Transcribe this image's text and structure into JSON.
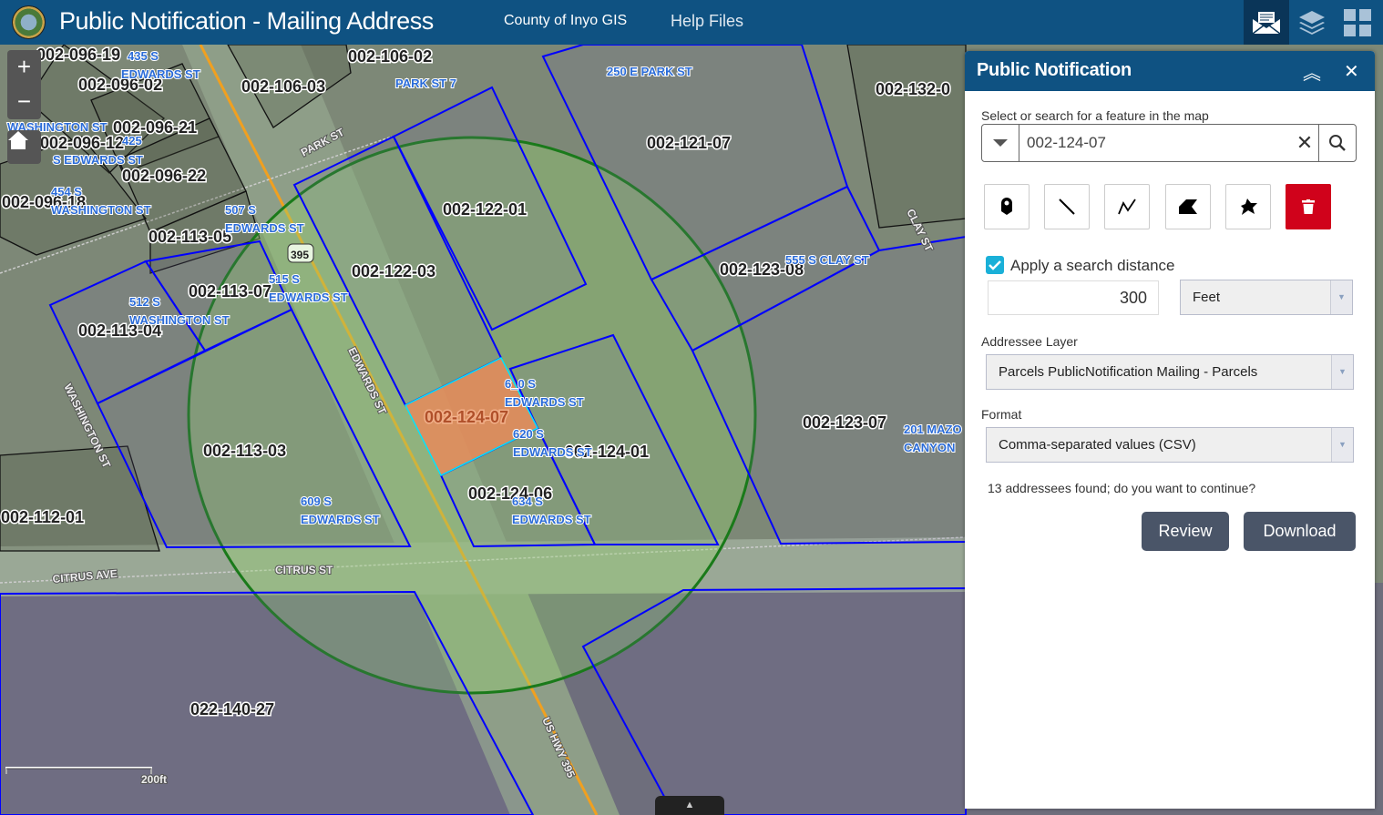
{
  "header": {
    "title": "Public Notification - Mailing Address",
    "links": [
      "County of Inyo GIS",
      "Help Files"
    ],
    "buttons": [
      "mail-icon",
      "layers-icon",
      "grid-icon"
    ]
  },
  "map": {
    "parcel_labels": [
      "002-096-19",
      "002-096-02",
      "002-106-03",
      "002-106-02",
      "002-096-21",
      "002-096-12",
      "002-096-22",
      "002-096-18",
      "002-113-05",
      "002-113-07",
      "002-113-04",
      "002-113-03",
      "002-112-01",
      "002-122-03",
      "002-122-01",
      "002-121-07",
      "002-123-08",
      "002-124-07",
      "002-124-01",
      "002-124-06",
      "002-123-07",
      "002-132-0",
      "022-140-27"
    ],
    "address_labels": [
      "435 S",
      "EDWARDS ST",
      "PARK ST 7",
      "250 E PARK ST",
      "WASHINGTON ST",
      "425",
      "S EDWARDS ST",
      "454 S",
      "WASHINGTON ST",
      "507 S",
      "EDWARDS ST",
      "515 S",
      "EDWARDS ST",
      "512 S",
      "WASHINGTON ST",
      "555 S CLAY ST",
      "6_0 S",
      "EDWARDS ST",
      "620 S",
      "EDWARDS ST",
      "634 S",
      "EDWARDS ST",
      "609 S",
      "EDWARDS ST",
      "201 MAZO",
      "CANYON"
    ],
    "street_labels": [
      "PARK ST",
      "EDWARDS ST",
      "WASHINGTON ST",
      "CLAY ST",
      "CITRUS AVE",
      "CITRUS ST",
      "US HWY 395",
      "395"
    ],
    "scale_label": "200ft",
    "search_distance_ft": 300,
    "colors": {
      "parcel_outline": "#0000ff",
      "buffer": "#1a7a1a",
      "selected": "#e8895a",
      "header": "#0f5282"
    }
  },
  "panel": {
    "title": "Public Notification",
    "search_label": "Select or search for a feature in the map",
    "search_value": "002-124-07",
    "tools": [
      "point-icon",
      "line-icon",
      "polyline-icon",
      "polygon-icon",
      "freehand-polygon-icon",
      "trash-icon"
    ],
    "apply_distance_label": "Apply a search distance",
    "apply_distance_checked": true,
    "distance": "300",
    "unit": "Feet",
    "addressee_label": "Addressee Layer",
    "addressee_value": "Parcels PublicNotification Mailing - Parcels",
    "format_label": "Format",
    "format_value": "Comma-separated values (CSV)",
    "status": "13 addressees found; do you want to continue?",
    "review": "Review",
    "download": "Download"
  }
}
